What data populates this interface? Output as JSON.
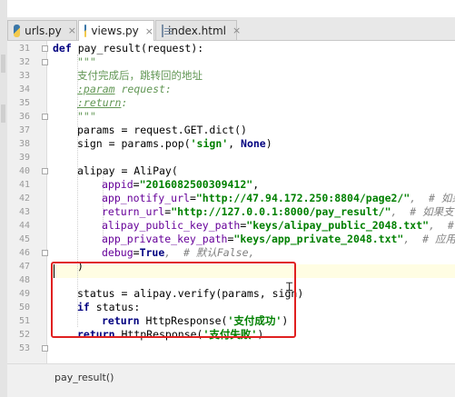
{
  "tabs": [
    {
      "label": "urls.py",
      "icon": "python-file-icon",
      "active": false
    },
    {
      "label": "views.py",
      "icon": "python-file-icon",
      "active": true
    },
    {
      "label": "index.html",
      "icon": "html-file-icon",
      "active": false
    }
  ],
  "close_glyph": "×",
  "line_numbers": [
    "31",
    "32",
    "33",
    "34",
    "35",
    "36",
    "37",
    "38",
    "39",
    "40",
    "41",
    "42",
    "43",
    "44",
    "45",
    "46",
    "47",
    "48",
    "49",
    "50",
    "51",
    "52",
    "53"
  ],
  "code": {
    "l31_kw": "def",
    "l31_rest": " pay_result(request):",
    "l32": "\"\"\"",
    "l33": "支付完成后，跳转回的地址",
    "l34_tag": ":param",
    "l34_rest": " request:",
    "l35_tag": ":return",
    "l35_rest": ":",
    "l36": "\"\"\"",
    "l37": "params = request.GET.dict()",
    "l38_a": "sign = params.pop(",
    "l38_str": "'sign'",
    "l38_b": ", ",
    "l38_none": "None",
    "l38_c": ")",
    "l40": "alipay = AliPay(",
    "l41_k": "appid",
    "l41_v": "\"2016082500309412\"",
    "l41_end": ",",
    "l42_k": "app_notify_url",
    "l42_v": "\"http://47.94.172.250:8804/page2/\"",
    "l42_c": ",  # 如果支",
    "l43_k": "return_url",
    "l43_v": "\"http://127.0.0.1:8000/pay_result/\"",
    "l43_c": ",  # 如果支付成",
    "l44_k": "alipay_public_key_path",
    "l44_v": "\"keys/alipay_public_2048.txt\"",
    "l44_c": ",  # 支",
    "l45_k": "app_private_key_path",
    "l45_v": "\"keys/app_private_2048.txt\"",
    "l45_c": ",  # 应用私",
    "l46_k": "debug",
    "l46_v": "True",
    "l46_c": ",  # 默认False,",
    "l47": ")",
    "l49": "status = alipay.verify(params, sign)",
    "l50_kw": "if",
    "l50_rest": " status:",
    "l51_kw": "return",
    "l51_a": " HttpResponse(",
    "l51_str": "'支付成功'",
    "l51_b": ")",
    "l52_kw": "return",
    "l52_a": " HttpResponse(",
    "l52_str": "'支付失败'",
    "l52_b": ")"
  },
  "breadcrumb": "pay_result()",
  "colors": {
    "highlight_box": "#e02020",
    "keyword": "#000080",
    "string": "#008000",
    "docstring": "#629755",
    "kwarg": "#660099",
    "comment": "#808080"
  }
}
